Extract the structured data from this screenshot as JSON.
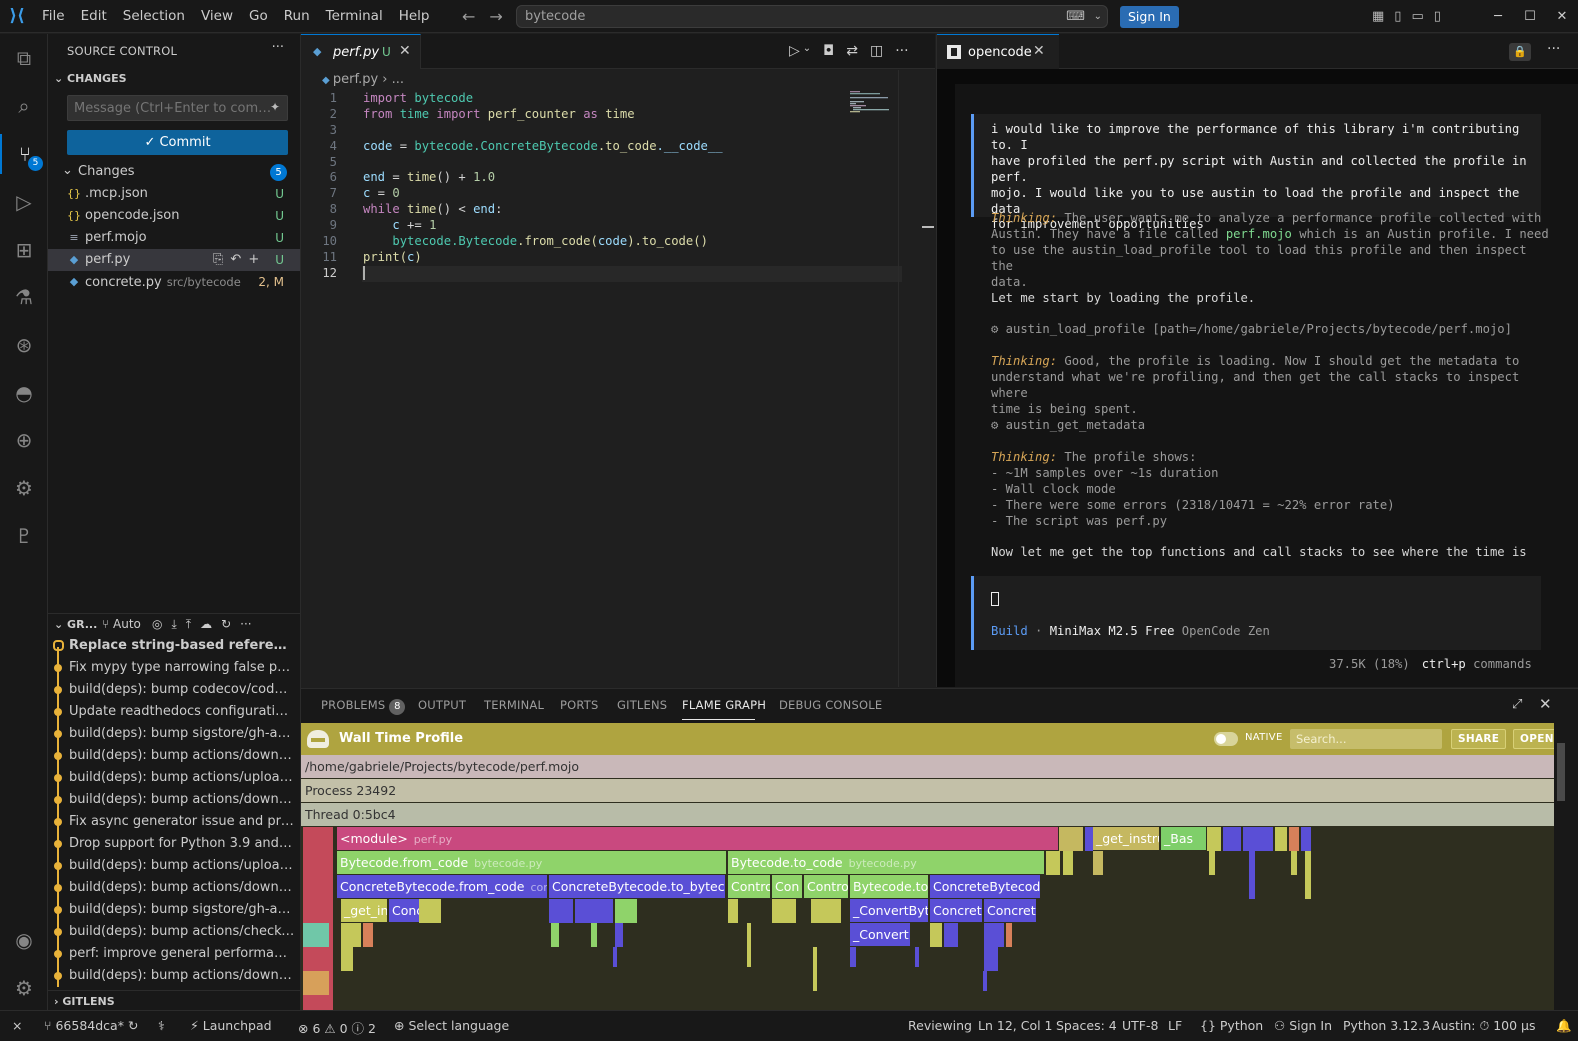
{
  "titlebar": {
    "menu": [
      "File",
      "Edit",
      "Selection",
      "View",
      "Go",
      "Run",
      "Terminal",
      "Help"
    ],
    "search": "bytecode",
    "sign_in": "Sign In"
  },
  "activity": {
    "scm_badge": "5"
  },
  "sidebar": {
    "title": "SOURCE CONTROL",
    "section": "CHANGES",
    "commit_placeholder": "Message (Ctrl+Enter to com…",
    "commit_button": "✓ Commit",
    "changes_label": "Changes",
    "changes_count": "5",
    "files": [
      {
        "name": ".mcp.json",
        "path": "",
        "status": "U",
        "icon": "json-icon"
      },
      {
        "name": "opencode.json",
        "path": "",
        "status": "U",
        "icon": "json-icon"
      },
      {
        "name": "perf.mojo",
        "path": "",
        "status": "U",
        "icon": "text-file-icon"
      },
      {
        "name": "perf.py",
        "path": "",
        "status": "U",
        "icon": "python-icon"
      },
      {
        "name": "concrete.py",
        "path": "src/bytecode",
        "status": "2, M",
        "icon": "python-icon"
      }
    ],
    "graph": {
      "title": "GR...",
      "auto": "Auto",
      "commits": [
        "Replace string-based references ...",
        "Fix mypy type narrowing false posi...",
        "build(deps): bump codecov/codeco...",
        "Update readthedocs configuration...",
        "build(deps): bump sigstore/gh-acti...",
        "build(deps): bump actions/downlo...",
        "build(deps): bump actions/upload-...",
        "build(deps): bump actions/downlo...",
        "Fix async generator issue and pref...",
        "Drop support for Python 3.9  and 3...",
        "build(deps): bump actions/upload-...",
        "build(deps): bump actions/downlo...",
        "build(deps): bump sigstore/gh-acti...",
        "build(deps): bump actions/checkou...",
        "perf: improve general performanc...",
        "build(deps): bump actions/downlo..."
      ]
    },
    "gitlens": "GITLENS"
  },
  "editor": {
    "tab_label": "perf.py",
    "tab_status": "U",
    "breadcrumb": "perf.py  ›  ...",
    "lines": [
      {
        "n": "1"
      },
      {
        "n": "2"
      },
      {
        "n": "3"
      },
      {
        "n": "4"
      },
      {
        "n": "5"
      },
      {
        "n": "6"
      },
      {
        "n": "7"
      },
      {
        "n": "8"
      },
      {
        "n": "9"
      },
      {
        "n": "10"
      },
      {
        "n": "11"
      },
      {
        "n": "12"
      }
    ],
    "code": {
      "l1_kw": "import",
      "l1_mod": "bytecode",
      "l2_kw1": "from",
      "l2_mod": "time",
      "l2_kw2": "import",
      "l2_fn": "perf_counter",
      "l2_kw3": "as",
      "l2_alias": "time",
      "l4_var": "code",
      "l4_op": " = ",
      "l4_mod": "bytecode",
      "l4_cls": ".ConcreteBytecode",
      "l4_fn": ".to_code",
      "l4_attr": ".__code__",
      "l6_var": "end",
      "l6_op": " = ",
      "l6_fn": "time",
      "l6_rest": "() + ",
      "l6_num": "1.0",
      "l7_var": "c",
      "l7_op": " = ",
      "l7_num": "0",
      "l8_kw": "while",
      "l8_fn": "time",
      "l8_rest": "() < ",
      "l8_var": "end",
      "l8_colon": ":",
      "l9_var": "c",
      "l9_op": " += ",
      "l9_num": "1",
      "l10_mod": "bytecode",
      "l10_cls": ".Bytecode",
      "l10_fn1": ".from_code",
      "l10_p1": "(",
      "l10_arg": "code",
      "l10_p2": ")",
      "l10_fn2": ".to_code",
      "l10_p3": "()",
      "l11_fn": "print",
      "l11_p1": "(",
      "l11_arg": "c",
      "l11_p2": ")"
    }
  },
  "opencode": {
    "tab_label": "opencode",
    "prompt": "i would like to improve the performance of this library i'm contributing to. I\nhave profiled the perf.py script with Austin and collected the profile in perf.\nmojo. I would like you to use austin to load the profile and inspect the data\nfor improvement opportunities",
    "thinking_label": "Thinking:",
    "t1_a": " The user wants me to analyze a performance profile collected with\nAustin. They have a file called ",
    "t1_file": "perf.mojo",
    "t1_b": " which is an Austin profile. I need\nto use the austin_load_profile tool to load this profile and then inspect the\ndata.",
    "msg1": "Let me start by loading the profile.",
    "tool1": "⚙ austin_load_profile [path=/home/gabriele/Projects/bytecode/perf.mojo]",
    "t2": " Good, the profile is loading. Now I should get the metadata to\nunderstand what we're profiling, and then get the call stacks to inspect where\ntime is being spent.",
    "tool2": "⚙ austin_get_metadata",
    "t3": " The profile shows:\n- ~1M samples over ~1s duration\n- Wall clock mode\n- There were some errors (2318/10471 = ~22% error rate)\n- The script was perf.py",
    "msg2": "Now let me get the top functions and call stacks to see where the time is",
    "mode": "Build",
    "sep": " · ",
    "model": "MiniMax M2.5 Free",
    "provider": "OpenCode Zen",
    "tokens": "37.5K (18%)",
    "keys": "ctrl+p",
    "keys_label": "commands"
  },
  "panel": {
    "tabs": [
      "PROBLEMS",
      "OUTPUT",
      "TERMINAL",
      "PORTS",
      "GITLENS",
      "FLAME GRAPH",
      "DEBUG CONSOLE"
    ],
    "problems_count": "8"
  },
  "flame": {
    "title": "Wall Time Profile",
    "native": "NATIVE",
    "search_placeholder": "Search...",
    "share": "SHARE",
    "open": "OPEN",
    "path": "/home/gabriele/Projects/bytecode/perf.mojo",
    "process": "Process 23492",
    "thread": "Thread 0:5bc4",
    "frames": {
      "module": "<module>",
      "module_file": "perf.py",
      "get_instru": "_get_instru",
      "bas": "_Bas",
      "from_code": "Bytecode.from_code",
      "from_code_file": "bytecode.py",
      "to_code": "Bytecode.to_code",
      "to_code_file": "bytecode.py",
      "cb_from_code": "ConcreteBytecode.from_code",
      "cb_from_code_file": "conc",
      "cb_to_byteco": "ConcreteBytecode.to_byteco",
      "contro1": "Contro",
      "con": "Con",
      "contro2": "Contro",
      "bytecode_to": "Bytecode.to_",
      "cb_short": "ConcreteBytecode",
      "get_in": "_get_in",
      "conc": "Conc",
      "convert_byte": "_ConvertByte",
      "concrete1": "Concrete",
      "concrete2": "Concrete",
      "convert": "_Convert"
    }
  },
  "status": {
    "branch": "66584dca*",
    "launchpad": "Launchpad",
    "errors": "6",
    "warnings": "0",
    "infos": "2",
    "language_select": "Select language",
    "reviewing": "Reviewing",
    "position": "Ln 12, Col 1",
    "spaces": "Spaces: 4",
    "encoding": "UTF-8",
    "eol": "LF",
    "language": "Python",
    "sign_in": "Sign In",
    "python_version": "Python 3.12.3",
    "austin": "Austin:",
    "austin_interval": "100 μs"
  },
  "colors": {
    "accent": "#0078d4",
    "flame_header": "#afa440",
    "module_frame": "#c9497f",
    "green_frame": "#8fd36a",
    "blue_frame": "#5a4fd6",
    "yellow_frame": "#c5c85a"
  }
}
